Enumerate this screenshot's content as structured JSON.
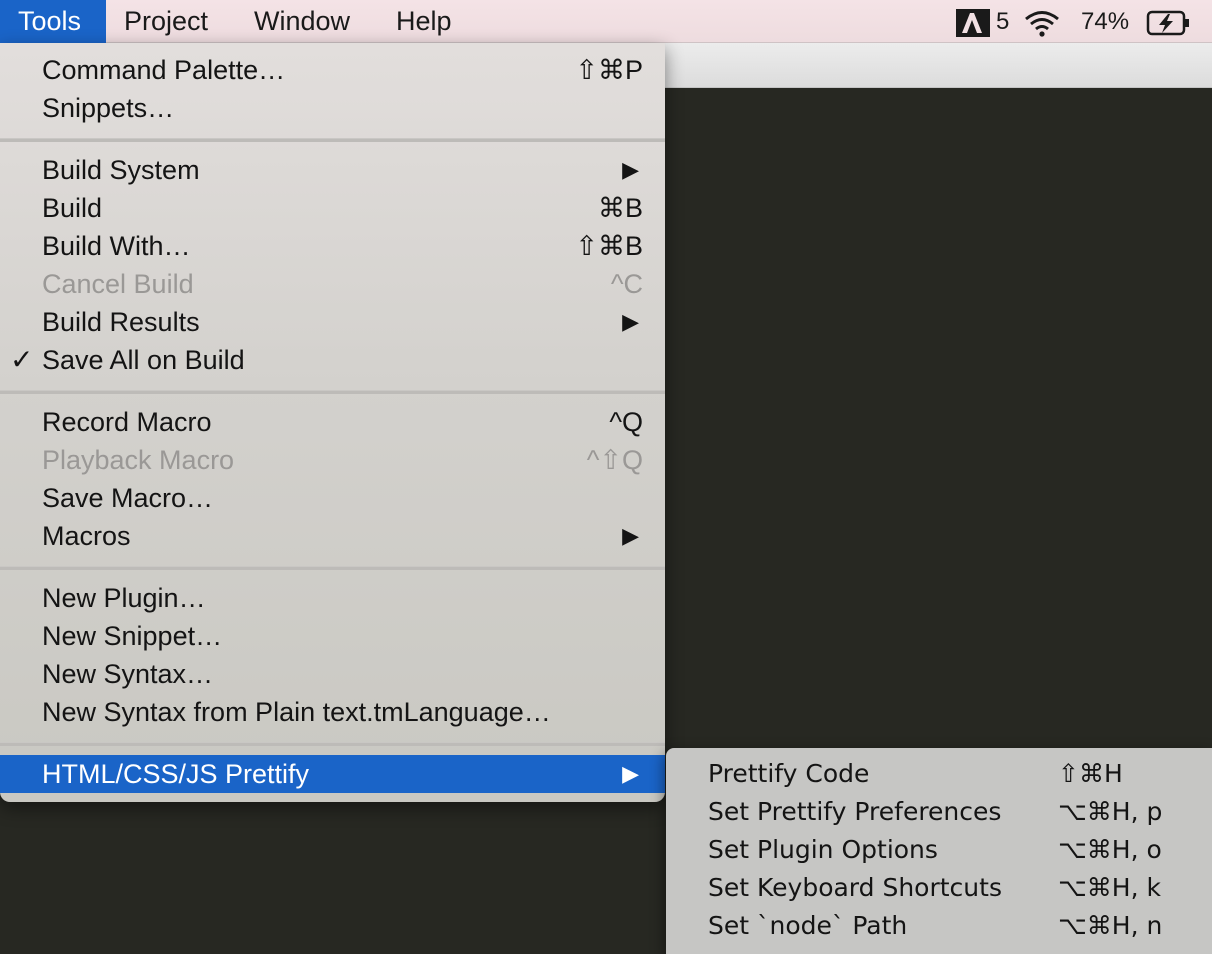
{
  "menubar": {
    "items": [
      {
        "label": "Tools"
      },
      {
        "label": "Project"
      },
      {
        "label": "Window"
      },
      {
        "label": "Help"
      }
    ],
    "status": {
      "adobe_icon": "adobe-icon",
      "adobe_badge": "5",
      "wifi_icon": "wifi-icon",
      "battery_percent": "74%",
      "battery_icon": "battery-charging-icon"
    }
  },
  "tools_menu": {
    "items": [
      {
        "label": "Command Palette…",
        "shortcut": "⇧⌘P"
      },
      {
        "label": "Snippets…",
        "shortcut": ""
      },
      {
        "label": "Build System",
        "shortcut": ""
      },
      {
        "label": "Build",
        "shortcut": "⌘B"
      },
      {
        "label": "Build With…",
        "shortcut": "⇧⌘B"
      },
      {
        "label": "Cancel Build",
        "shortcut": "^C"
      },
      {
        "label": "Build Results",
        "shortcut": ""
      },
      {
        "label": "Save All on Build",
        "shortcut": ""
      },
      {
        "label": "Record Macro",
        "shortcut": "^Q"
      },
      {
        "label": "Playback Macro",
        "shortcut": "^⇧Q"
      },
      {
        "label": "Save Macro…",
        "shortcut": ""
      },
      {
        "label": "Macros",
        "shortcut": ""
      },
      {
        "label": "New Plugin…",
        "shortcut": ""
      },
      {
        "label": "New Snippet…",
        "shortcut": ""
      },
      {
        "label": "New Syntax…",
        "shortcut": ""
      },
      {
        "label": "New Syntax from Plain text.tmLanguage…",
        "shortcut": ""
      },
      {
        "label": "HTML/CSS/JS Prettify",
        "shortcut": ""
      }
    ],
    "submenu_arrow": "▶",
    "check_mark": "✓"
  },
  "prettify_submenu": {
    "items": [
      {
        "label": "Prettify Code",
        "shortcut": "⇧⌘H"
      },
      {
        "label": "Set Prettify Preferences",
        "shortcut": "⌥⌘H, p"
      },
      {
        "label": "Set Plugin Options",
        "shortcut": "⌥⌘H, o"
      },
      {
        "label": "Set Keyboard Shortcuts",
        "shortcut": "⌥⌘H, k"
      },
      {
        "label": "Set `node` Path",
        "shortcut": "⌥⌘H, n"
      }
    ]
  },
  "colors": {
    "highlight": "#1a64c8",
    "editor_bg": "#272822",
    "disabled_text": "#9a9896"
  }
}
